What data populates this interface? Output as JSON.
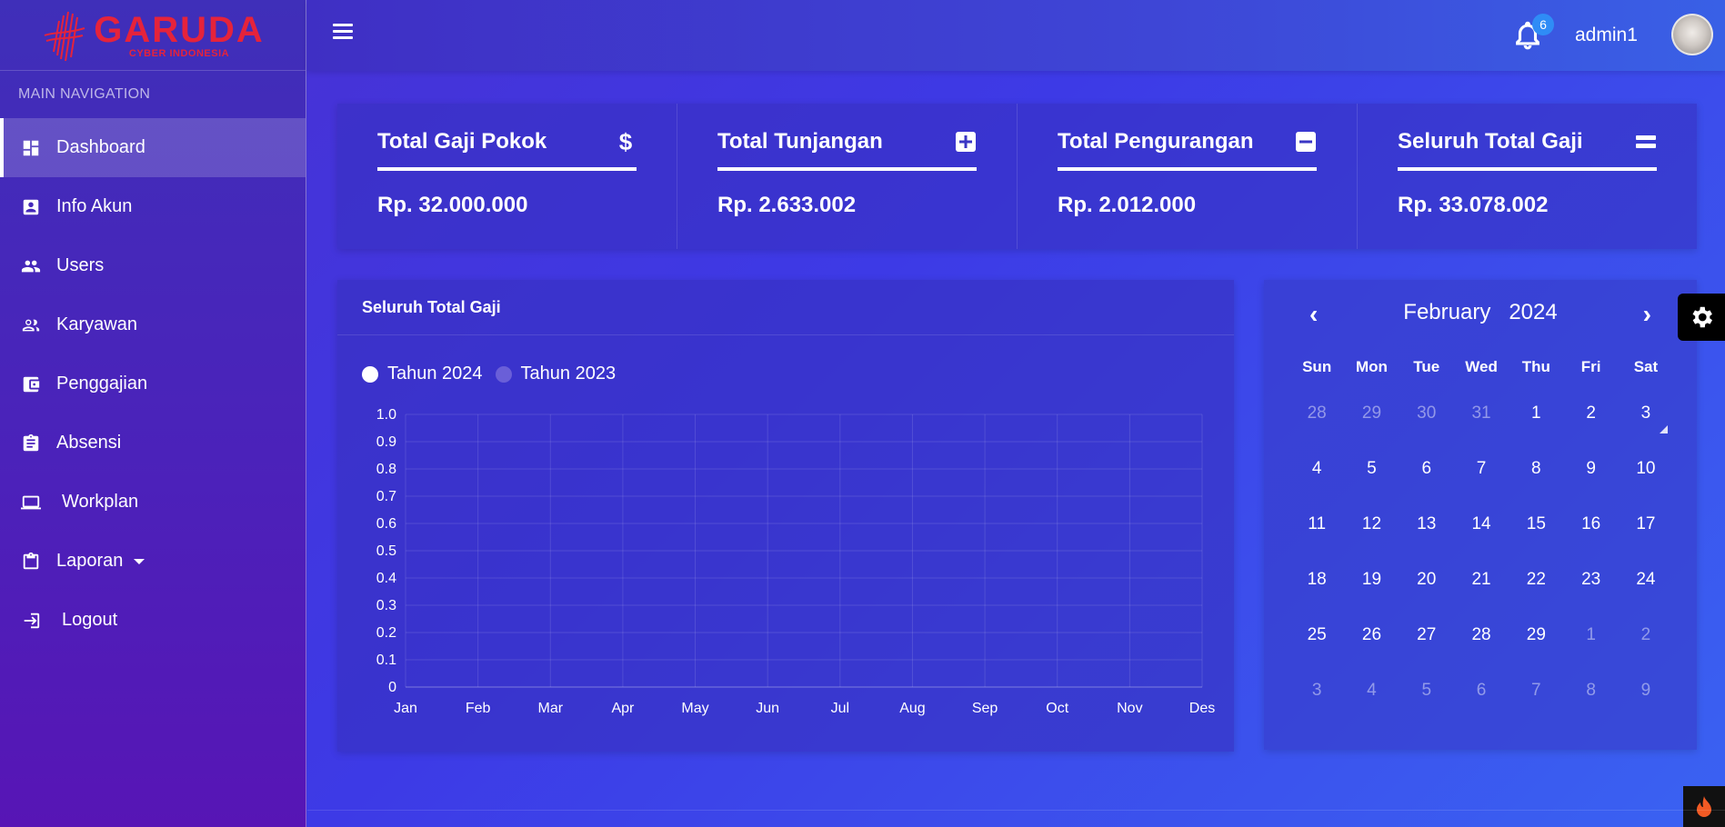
{
  "brand": {
    "name": "GARUDA",
    "subtitle": "CYBER INDONESIA"
  },
  "sidebar": {
    "section_title": "MAIN NAVIGATION",
    "items": [
      {
        "label": "Dashboard",
        "icon": "dashboard-icon",
        "active": true
      },
      {
        "label": "Info Akun",
        "icon": "account-box-icon"
      },
      {
        "label": "Users",
        "icon": "users-icon"
      },
      {
        "label": "Karyawan",
        "icon": "employees-icon"
      },
      {
        "label": "Penggajian",
        "icon": "wallet-icon"
      },
      {
        "label": "Absensi",
        "icon": "clipboard-icon"
      },
      {
        "label": "Workplan",
        "icon": "laptop-icon"
      },
      {
        "label": "Laporan",
        "icon": "report-icon",
        "has_dropdown": true
      },
      {
        "label": "Logout",
        "icon": "logout-icon"
      }
    ]
  },
  "topbar": {
    "notification_count": "6",
    "username": "admin1"
  },
  "stats": [
    {
      "title": "Total Gaji Pokok",
      "icon": "dollar-icon",
      "value": "Rp. 32.000.000"
    },
    {
      "title": "Total Tunjangan",
      "icon": "plus-square-icon",
      "value": "Rp. 2.633.002"
    },
    {
      "title": "Total Pengurangan",
      "icon": "minus-square-icon",
      "value": "Rp. 2.012.000"
    },
    {
      "title": "Seluruh Total Gaji",
      "icon": "equals-icon",
      "value": "Rp. 33.078.002"
    }
  ],
  "chart_card": {
    "title": "Seluruh Total Gaji"
  },
  "chart_data": {
    "type": "line",
    "categories": [
      "Jan",
      "Feb",
      "Mar",
      "Apr",
      "May",
      "Jun",
      "Jul",
      "Aug",
      "Sep",
      "Oct",
      "Nov",
      "Des"
    ],
    "y_ticks": [
      "1.0",
      "0.9",
      "0.8",
      "0.7",
      "0.6",
      "0.5",
      "0.4",
      "0.3",
      "0.2",
      "0.1",
      "0"
    ],
    "ylim": [
      0,
      1
    ],
    "grid": true,
    "legend_position": "top-left",
    "series": [
      {
        "name": "Tahun 2024",
        "values": [],
        "color": "#ffffff"
      },
      {
        "name": "Tahun 2023",
        "values": [],
        "color": "#6a5fd8"
      }
    ]
  },
  "calendar": {
    "month": "February",
    "year": "2024",
    "prev_symbol": "‹",
    "next_symbol": "›",
    "weekdays": [
      "Sun",
      "Mon",
      "Tue",
      "Wed",
      "Thu",
      "Fri",
      "Sat"
    ],
    "weeks": [
      [
        "28",
        "29",
        "30",
        "31",
        "1",
        "2",
        "3"
      ],
      [
        "4",
        "5",
        "6",
        "7",
        "8",
        "9",
        "10"
      ],
      [
        "11",
        "12",
        "13",
        "14",
        "15",
        "16",
        "17"
      ],
      [
        "18",
        "19",
        "20",
        "21",
        "22",
        "23",
        "24"
      ],
      [
        "25",
        "26",
        "27",
        "28",
        "29",
        "1",
        "2"
      ],
      [
        "3",
        "4",
        "5",
        "6",
        "7",
        "8",
        "9"
      ]
    ],
    "muted": [
      [
        true,
        true,
        true,
        true,
        false,
        false,
        false
      ],
      [
        false,
        false,
        false,
        false,
        false,
        false,
        false
      ],
      [
        false,
        false,
        false,
        false,
        false,
        false,
        false
      ],
      [
        false,
        false,
        false,
        false,
        false,
        false,
        false
      ],
      [
        false,
        false,
        false,
        false,
        false,
        true,
        true
      ],
      [
        true,
        true,
        true,
        true,
        true,
        true,
        true
      ]
    ],
    "today": {
      "week": 0,
      "day": 6
    }
  },
  "colors": {
    "accent_red": "#e5233b",
    "badge_blue": "#2f8cf6"
  }
}
